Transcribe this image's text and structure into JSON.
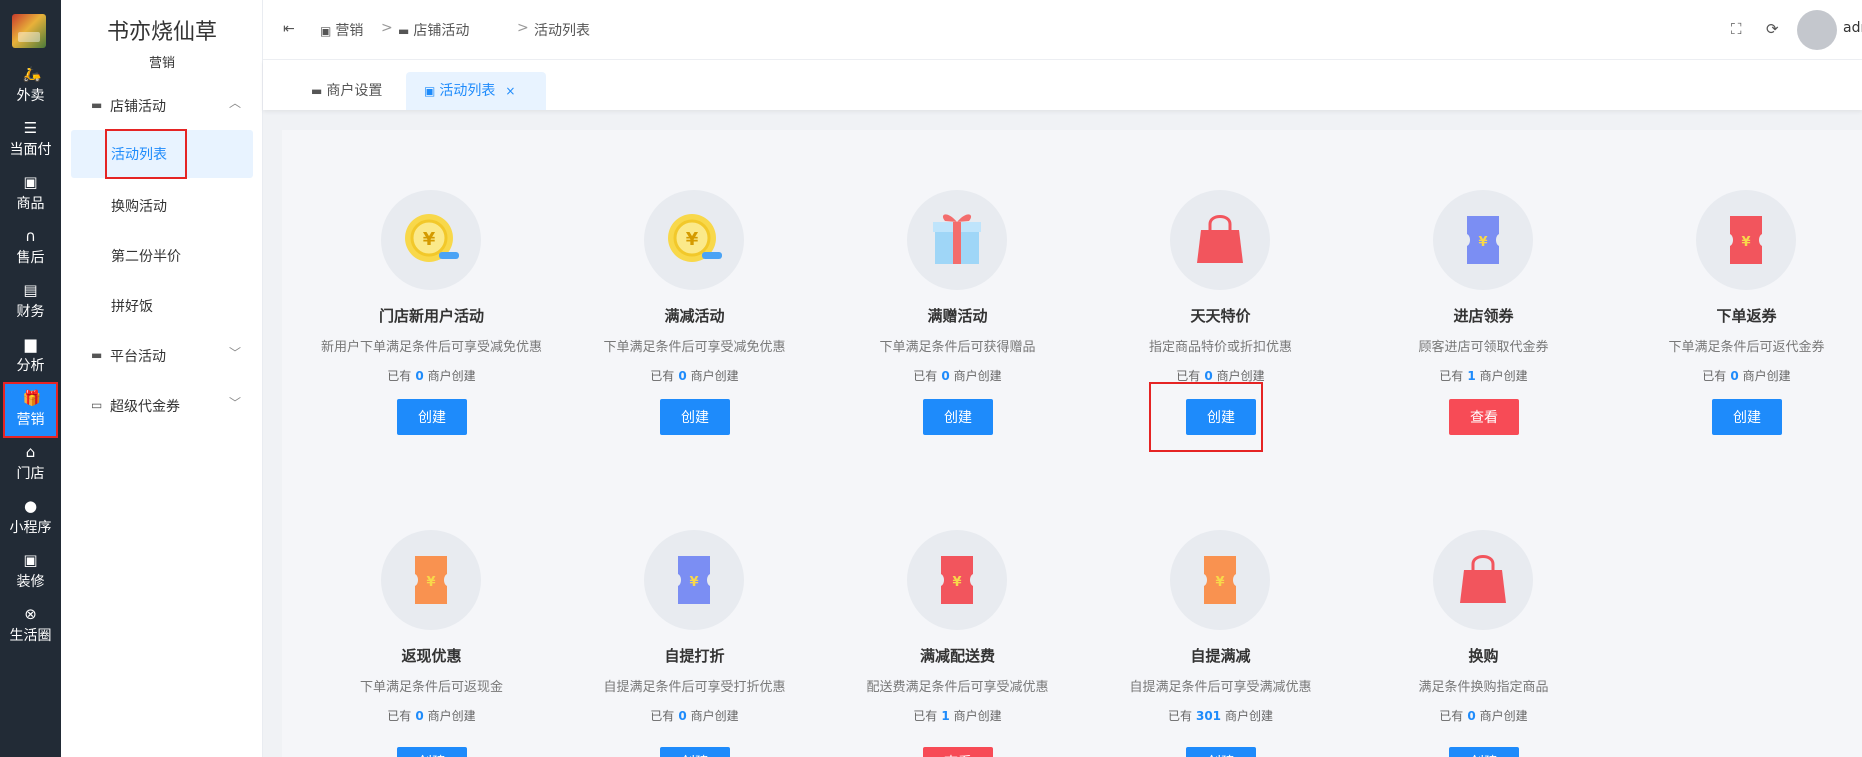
{
  "rail": {
    "items": [
      {
        "label": "外卖",
        "icon": "scooter-icon"
      },
      {
        "label": "当面付",
        "icon": "list-icon"
      },
      {
        "label": "商品",
        "icon": "shopping-bag-icon"
      },
      {
        "label": "售后",
        "icon": "headset-icon"
      },
      {
        "label": "财务",
        "icon": "finance-icon"
      },
      {
        "label": "分析",
        "icon": "bar-chart-icon"
      },
      {
        "label": "营销",
        "icon": "gift-icon"
      },
      {
        "label": "门店",
        "icon": "store-icon"
      },
      {
        "label": "小程序",
        "icon": "wechat-icon"
      },
      {
        "label": "装修",
        "icon": "paint-icon"
      },
      {
        "label": "生活圈",
        "icon": "circle-icon"
      }
    ],
    "active": "营销"
  },
  "submenu": {
    "brand": "书亦烧仙草",
    "section": "营销",
    "group_store": "店铺活动",
    "items": [
      "活动列表",
      "换购活动",
      "第二份半价",
      "拼好饭"
    ],
    "group_platform": "平台活动",
    "group_voucher": "超级代金券"
  },
  "header": {
    "crumbs": [
      "营销",
      "店铺活动",
      "活动列表"
    ],
    "separator": ">",
    "username": "admin"
  },
  "tabs": [
    {
      "label": "商户设置"
    },
    {
      "label": "活动列表",
      "close": "×"
    }
  ],
  "count_prefix": "已有",
  "count_suffix": "商户创建",
  "cards": [
    {
      "title": "门店新用户活动",
      "desc": "新用户下单满足条件后可享受减免优惠",
      "count": "0",
      "button": "创建",
      "icon": "yuan-coin-icon"
    },
    {
      "title": "满减活动",
      "desc": "下单满足条件后可享受减免优惠",
      "count": "0",
      "button": "创建",
      "icon": "yuan-coin-icon"
    },
    {
      "title": "满赠活动",
      "desc": "下单满足条件后可获得赠品",
      "count": "0",
      "button": "创建",
      "icon": "gift-box-icon"
    },
    {
      "title": "天天特价",
      "desc": "指定商品特价或折扣优惠",
      "count": "0",
      "button": "创建",
      "icon": "shopping-bag-icon"
    },
    {
      "title": "进店领券",
      "desc": "顾客进店可领取代金券",
      "count": "1",
      "button": "查看",
      "icon": "coupon-icon"
    },
    {
      "title": "下单返券",
      "desc": "下单满足条件后可返代金券",
      "count": "0",
      "button": "创建",
      "icon": "coupon-icon"
    },
    {
      "title": "返现优惠",
      "desc": "下单满足条件后可返现金",
      "count": "0",
      "button": "创建",
      "icon": "coupon-icon"
    },
    {
      "title": "自提打折",
      "desc": "自提满足条件后可享受打折优惠",
      "count": "0",
      "button": "创建",
      "icon": "coupon-icon"
    },
    {
      "title": "满减配送费",
      "desc": "配送费满足条件后可享受减优惠",
      "count": "1",
      "button": "查看",
      "icon": "coupon-icon"
    },
    {
      "title": "自提满减",
      "desc": "自提满足条件后可享受满减优惠",
      "count": "301",
      "button": "创建",
      "icon": "coupon-icon"
    },
    {
      "title": "换购",
      "desc": "满足条件换购指定商品",
      "count": "0",
      "button": "创建",
      "icon": "shopping-bag-icon"
    }
  ],
  "colors": {
    "rail_bg": "#222b36",
    "accent": "#1e8bfb",
    "view_button": "#f74b56",
    "highlight_box": "#e52424"
  }
}
